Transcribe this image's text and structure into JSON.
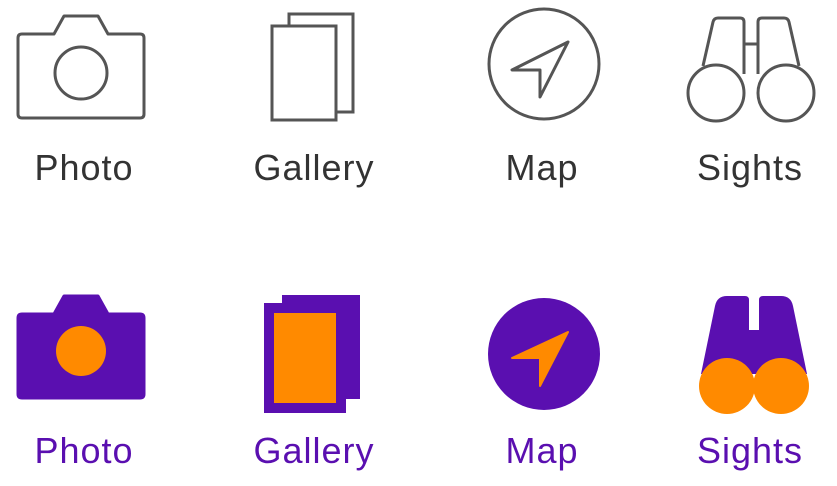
{
  "colors": {
    "inactive_stroke": "#555555",
    "inactive_text": "#333333",
    "active_fill": "#5a0fb0",
    "active_accent": "#ff8a00",
    "active_text": "#5a0fb0"
  },
  "tabs_outline": [
    {
      "label": "Photo",
      "icon": "camera-icon"
    },
    {
      "label": "Gallery",
      "icon": "gallery-icon"
    },
    {
      "label": "Map",
      "icon": "navigation-arrow-icon"
    },
    {
      "label": "Sights",
      "icon": "binoculars-icon"
    }
  ],
  "tabs_filled": [
    {
      "label": "Photo",
      "icon": "camera-icon"
    },
    {
      "label": "Gallery",
      "icon": "gallery-icon"
    },
    {
      "label": "Map",
      "icon": "navigation-arrow-icon"
    },
    {
      "label": "Sights",
      "icon": "binoculars-icon"
    }
  ]
}
